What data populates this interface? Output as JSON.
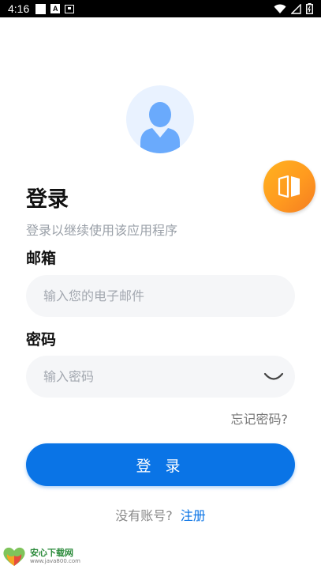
{
  "status_bar": {
    "time": "4:16",
    "icons": [
      "notification-square-icon",
      "a-badge-icon",
      "screenshot-icon",
      "wifi-icon",
      "signal-icon",
      "battery-icon"
    ]
  },
  "header": {
    "title": "登录",
    "subtitle": "登录以继续使用该应用程序"
  },
  "form": {
    "email_label": "邮箱",
    "email_placeholder": "输入您的电子邮件",
    "password_label": "密码",
    "password_placeholder": "输入密码",
    "forgot_password": "忘记密码?",
    "login_button": "登 录"
  },
  "footer": {
    "no_account": "没有账号?",
    "register_link": "注册"
  },
  "watermark": {
    "name": "安心下载网",
    "url": "www.java800.com"
  },
  "colors": {
    "primary": "#0a74e6",
    "float_button": "#ff9f1f",
    "field_bg": "#f5f6f8",
    "avatar_bg": "#e9f2ff",
    "avatar_fg": "#6aaafc"
  }
}
